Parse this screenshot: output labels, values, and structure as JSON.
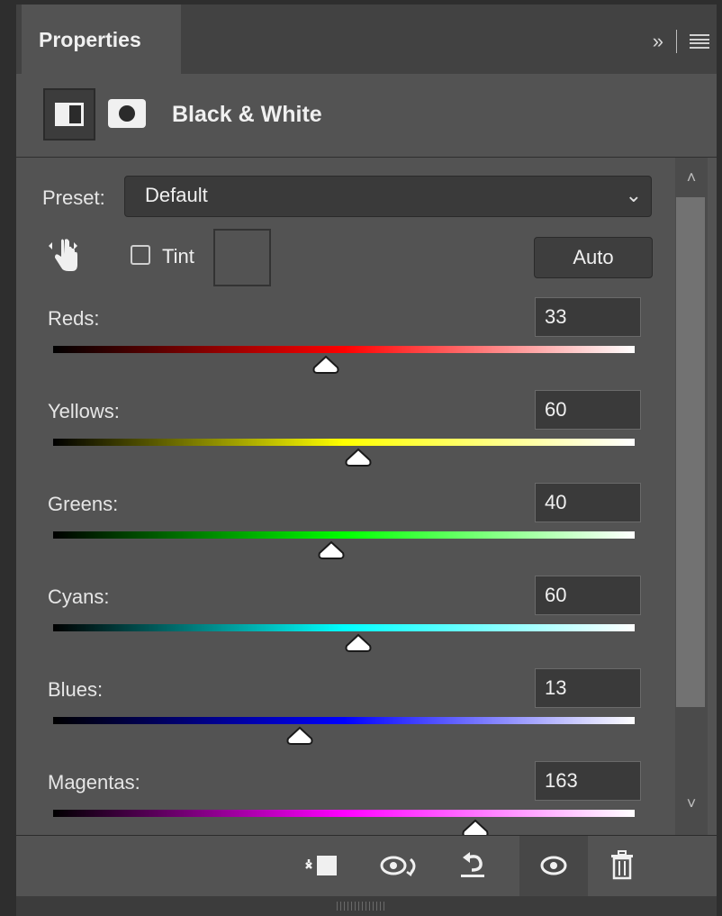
{
  "panel": {
    "tab_label": "Properties",
    "expand_glyph": "»",
    "adjustment_title": "Black & White"
  },
  "preset": {
    "label": "Preset:",
    "value": "Default",
    "chevron": "⌄"
  },
  "tint": {
    "label": "Tint",
    "checked": false
  },
  "auto_label": "Auto",
  "scroll": {
    "up": "˄",
    "down": "˅"
  },
  "sliders": [
    {
      "label": "Reds:",
      "value": "33",
      "position": 0.469,
      "colors": [
        "#000000",
        "#ff0000",
        "#ffffff"
      ]
    },
    {
      "label": "Yellows:",
      "value": "60",
      "position": 0.525,
      "colors": [
        "#000000",
        "#ffff00",
        "#ffffff"
      ]
    },
    {
      "label": "Greens:",
      "value": "40",
      "position": 0.479,
      "colors": [
        "#000000",
        "#00ff00",
        "#ffffff"
      ]
    },
    {
      "label": "Cyans:",
      "value": "60",
      "position": 0.525,
      "colors": [
        "#000000",
        "#00ffff",
        "#ffffff"
      ]
    },
    {
      "label": "Blues:",
      "value": "13",
      "position": 0.424,
      "colors": [
        "#000000",
        "#0000ff",
        "#ffffff"
      ]
    },
    {
      "label": "Magentas:",
      "value": "163",
      "position": 0.726,
      "colors": [
        "#000000",
        "#ff00ff",
        "#ffffff"
      ]
    }
  ],
  "colors": {
    "panel_bg": "#535353",
    "tab_bar_bg": "#424242",
    "input_bg": "#3a3a3a"
  },
  "bottom_icons": [
    "clip-to-layer-icon",
    "view-previous-state-icon",
    "reset-icon",
    "visibility-icon",
    "trash-icon"
  ]
}
